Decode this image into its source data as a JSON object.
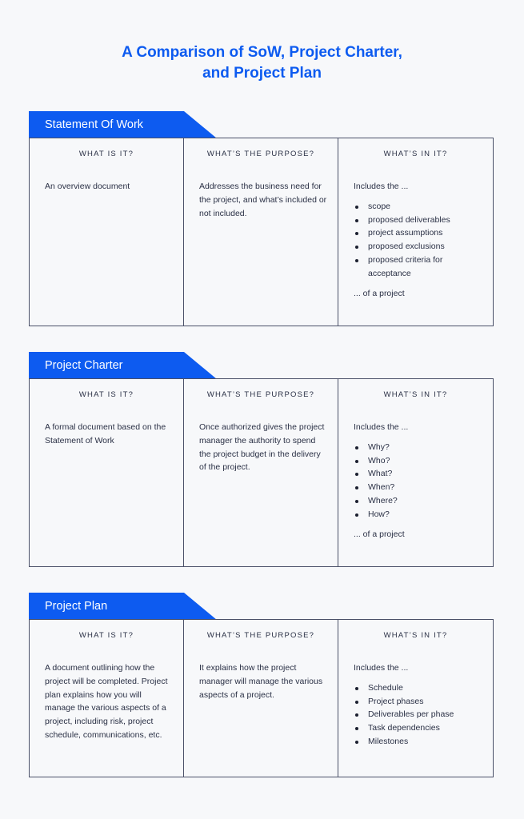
{
  "title_line1": "A Comparison of SoW, Project Charter,",
  "title_line2": "and Project Plan",
  "accent_color": "#0d5bf0",
  "sections": [
    {
      "name": "Statement Of Work",
      "what_is_it_header": "WHAT IS IT?",
      "purpose_header": "WHAT’S THE PURPOSE?",
      "contents_header": "WHAT’S IN IT?",
      "what_is_it": "An overview document",
      "purpose": "Addresses the business need for the project, and what’s included or not included.",
      "contents_intro": "Includes the ...",
      "contents_items": [
        "scope",
        "proposed deliverables",
        "project assumptions",
        "proposed exclusions",
        "proposed criteria for acceptance"
      ],
      "contents_suffix": "... of a project"
    },
    {
      "name": "Project Charter",
      "what_is_it_header": "WHAT IS IT?",
      "purpose_header": "WHAT’S THE PURPOSE?",
      "contents_header": "WHAT’S IN IT?",
      "what_is_it": "A formal document based on the Statement of Work",
      "purpose": "Once authorized gives the project manager the authority to spend the project budget in the delivery of the project.",
      "contents_intro": "Includes the ...",
      "contents_items": [
        "Why?",
        "Who?",
        "What?",
        "When?",
        "Where?",
        "How?"
      ],
      "contents_suffix": "... of a project"
    },
    {
      "name": "Project Plan",
      "what_is_it_header": "WHAT IS IT?",
      "purpose_header": "WHAT’S THE PURPOSE?",
      "contents_header": "WHAT’S IN IT?",
      "what_is_it": "A document outlining how the project will be completed. Project plan explains how you will manage the various aspects of a project, including risk, project schedule, communications, etc.",
      "purpose": "It explains how the project manager will manage the various aspects of a project.",
      "contents_intro": "Includes the ...",
      "contents_items": [
        "Schedule",
        "Project phases",
        "Deliverables per phase",
        "Task dependencies",
        "Milestones"
      ],
      "contents_suffix": ""
    }
  ]
}
